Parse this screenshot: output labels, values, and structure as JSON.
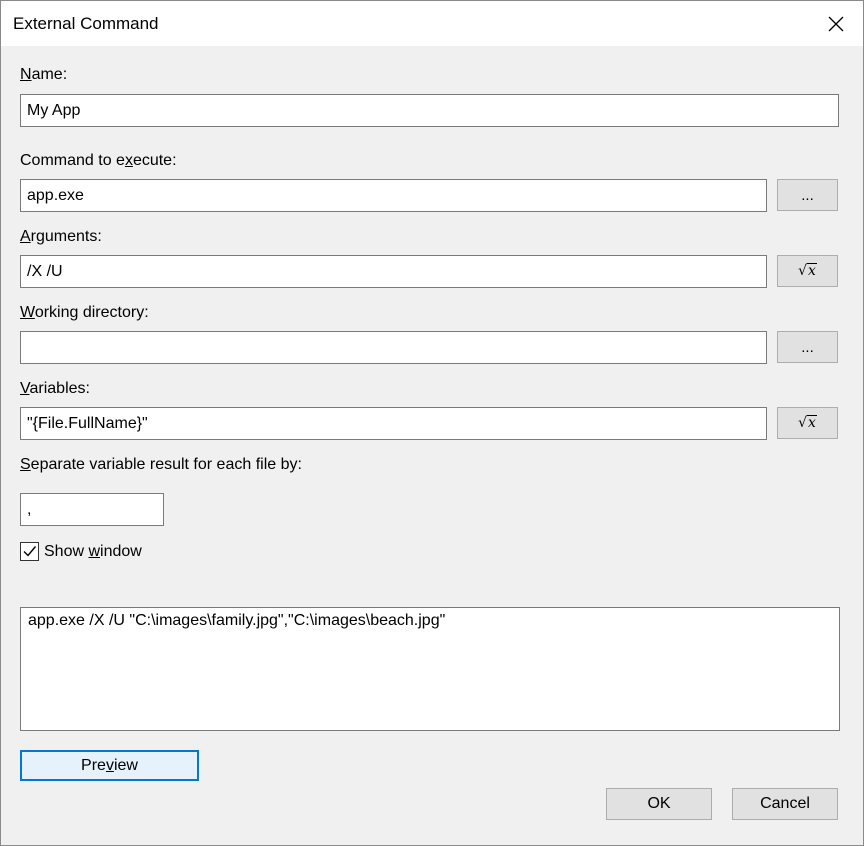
{
  "window": {
    "title": "External Command"
  },
  "fields": {
    "name": {
      "label_pre": "",
      "label_acc": "N",
      "label_post": "ame:",
      "value": "My App"
    },
    "command": {
      "label_pre": "Command to e",
      "label_acc": "x",
      "label_post": "ecute:",
      "value": "app.exe",
      "button": "..."
    },
    "arguments": {
      "label_pre": "",
      "label_acc": "A",
      "label_post": "rguments:",
      "value": "/X /U"
    },
    "working_dir": {
      "label_pre": "",
      "label_acc": "W",
      "label_post": "orking directory:",
      "value": "",
      "button": "..."
    },
    "variables": {
      "label_pre": "",
      "label_acc": "V",
      "label_post": "ariables:",
      "value": "\"{File.FullName}\""
    },
    "separator": {
      "label_pre": "",
      "label_acc": "S",
      "label_post": "eparate variable result for each file by:",
      "value": ","
    }
  },
  "show_window": {
    "label_pre": "Show ",
    "label_acc": "w",
    "label_post": "indow",
    "checked": true
  },
  "preview_text": "app.exe /X /U \"C:\\images\\family.jpg\",\"C:\\images\\beach.jpg\"",
  "buttons": {
    "preview_pre": "Pre",
    "preview_acc": "v",
    "preview_post": "iew",
    "ok": "OK",
    "cancel": "Cancel"
  },
  "icons": {
    "close": "close-icon",
    "sqrt": "sqrt-x-icon",
    "check": "checkmark-icon"
  }
}
